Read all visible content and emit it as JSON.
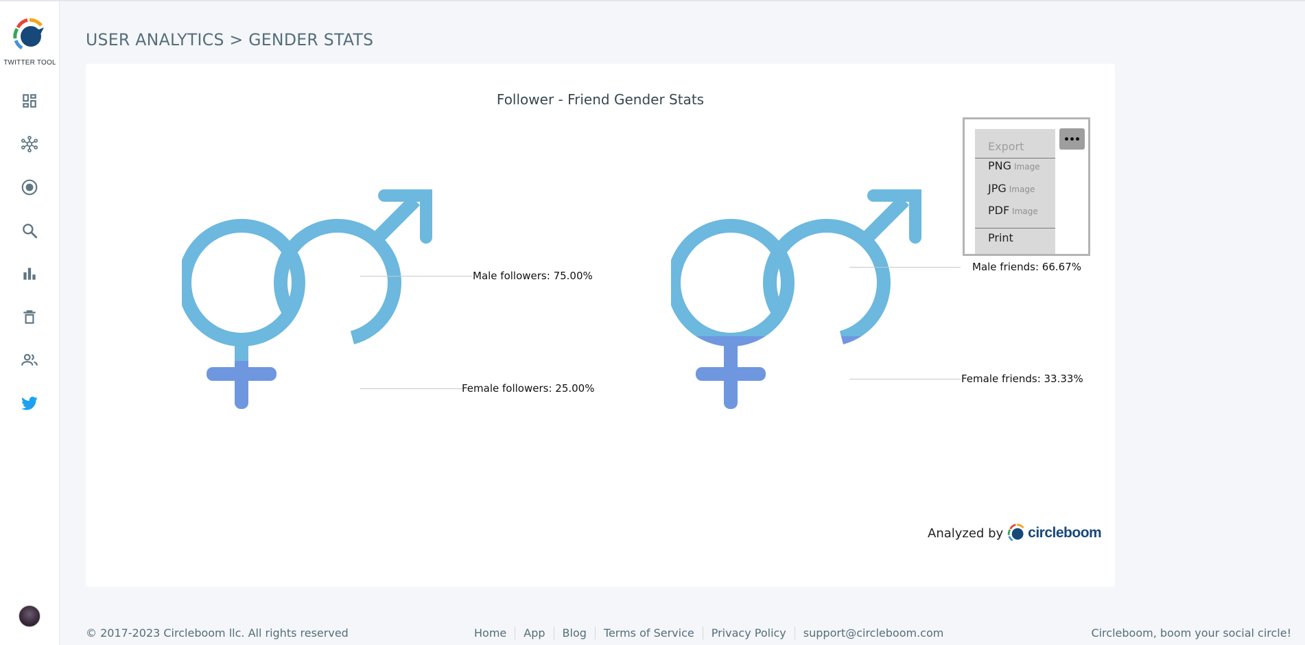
{
  "sidebar": {
    "logo_text": "TWITTER TOOL",
    "items": [
      {
        "icon": "dashboard-icon"
      },
      {
        "icon": "network-icon"
      },
      {
        "icon": "target-icon"
      },
      {
        "icon": "search-icon"
      },
      {
        "icon": "analytics-icon"
      },
      {
        "icon": "trash-icon"
      },
      {
        "icon": "users-icon"
      },
      {
        "icon": "twitter-icon"
      }
    ]
  },
  "header": {
    "title": "USER ANALYTICS > GENDER STATS"
  },
  "chart": {
    "title": "Follower - Friend Gender Stats",
    "labels": {
      "male_followers": "Male followers: 75.00%",
      "female_followers": "Female followers: 25.00%",
      "male_friends": "Male friends: 66.67%",
      "female_friends": "Female friends: 33.33%"
    }
  },
  "chart_data": {
    "type": "pie",
    "title": "Follower - Friend Gender Stats",
    "groups": [
      {
        "name": "followers",
        "slices": [
          {
            "label": "Male followers",
            "value": 75.0
          },
          {
            "label": "Female followers",
            "value": 25.0
          }
        ]
      },
      {
        "name": "friends",
        "slices": [
          {
            "label": "Male friends",
            "value": 66.67
          },
          {
            "label": "Female friends",
            "value": 33.33
          }
        ]
      }
    ],
    "colors": {
      "male": "#6cb8de",
      "female": "#6f97df"
    }
  },
  "export_menu": {
    "header": "Export",
    "items": [
      {
        "main": "PNG",
        "sub": "Image"
      },
      {
        "main": "JPG",
        "sub": "Image"
      },
      {
        "main": "PDF",
        "sub": "Image"
      },
      {
        "main": "Print",
        "sub": ""
      }
    ]
  },
  "analyzed_by": {
    "text": "Analyzed by",
    "brand": "circleboom"
  },
  "footer": {
    "copyright": "© 2017-2023 Circleboom llc. All rights reserved",
    "links": [
      "Home",
      "App",
      "Blog",
      "Terms of Service",
      "Privacy Policy",
      "support@circleboom.com"
    ],
    "tagline": "Circleboom, boom your social circle!"
  },
  "colors": {
    "accent": "#546e7a",
    "twitter": "#1da1f2",
    "brand_dark": "#17487a"
  }
}
